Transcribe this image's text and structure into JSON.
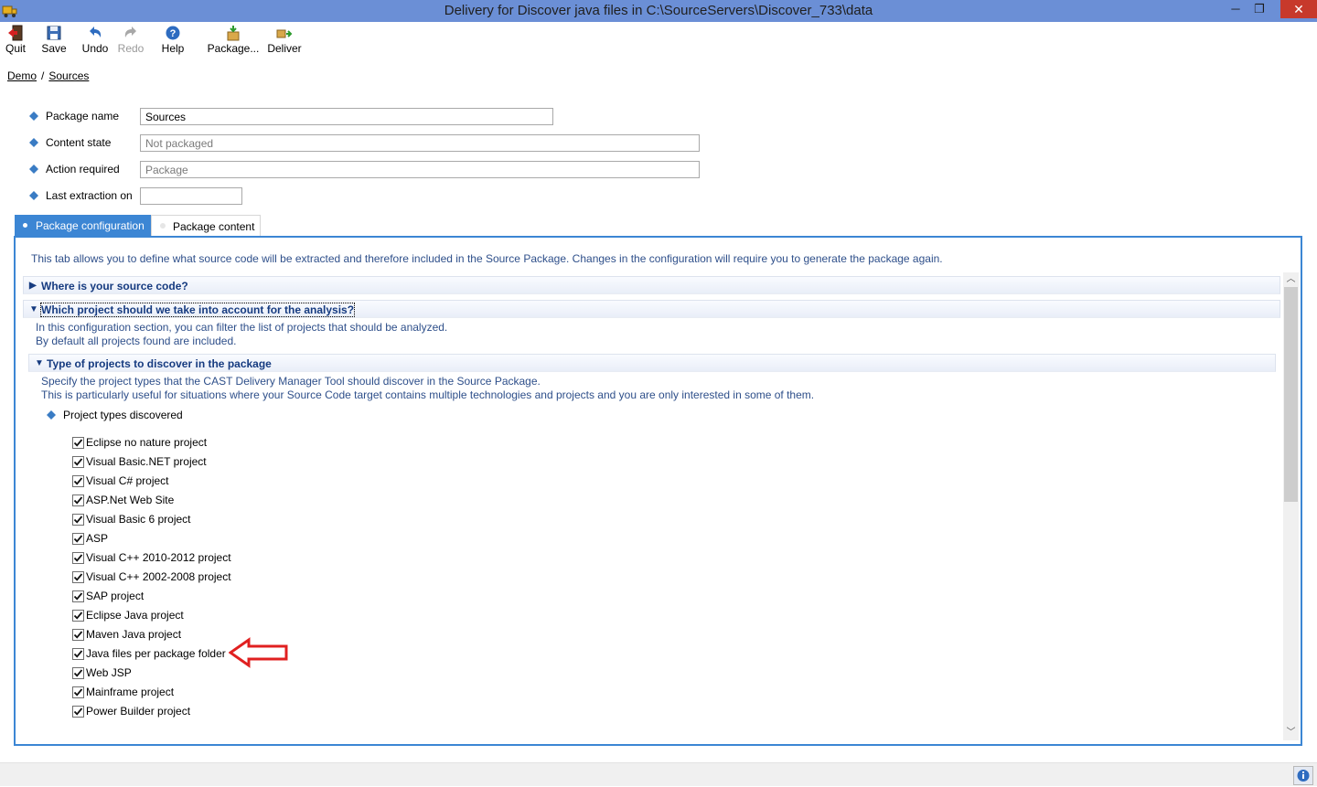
{
  "window": {
    "title": "Delivery for Discover java files in C:\\SourceServers\\Discover_733\\data",
    "minimize_glyph": "─",
    "restore_glyph": "❐",
    "close_glyph": "✕"
  },
  "toolbar": {
    "quit": "Quit",
    "save": "Save",
    "undo": "Undo",
    "redo": "Redo",
    "help": "Help",
    "package": "Package...",
    "deliver": "Deliver"
  },
  "breadcrumb": {
    "root": "Demo",
    "separator": "/",
    "current": "Sources"
  },
  "properties": {
    "package_name": {
      "label": "Package name",
      "value": "Sources"
    },
    "content_state": {
      "label": "Content state",
      "value": "Not packaged"
    },
    "action_required": {
      "label": "Action required",
      "value": "Package"
    },
    "last_extraction": {
      "label": "Last extraction on",
      "value": ""
    }
  },
  "tabs": {
    "config": "Package configuration",
    "content": "Package content"
  },
  "config": {
    "intro": "This tab allows you to define what source code will be extracted and therefore included in the Source Package. Changes in the configuration will require you to generate the package again.",
    "section_source": "Where is your source code?",
    "section_projects": "Which project should we take into account for the analysis?",
    "projects_desc_1": "In this configuration section, you can filter the list of projects that should be analyzed.",
    "projects_desc_2": "By default all projects found are included.",
    "section_types": "Type of projects to discover in the package",
    "types_desc_1": "Specify the project types that the CAST Delivery Manager Tool should discover in the Source Package.",
    "types_desc_2": "This is particularly useful for situations where your Source Code target contains multiple technologies and projects and you are only interested in some of them.",
    "types_label": "Project types discovered",
    "project_types": [
      {
        "label": "Eclipse no nature project",
        "checked": true
      },
      {
        "label": "Visual Basic.NET project",
        "checked": true
      },
      {
        "label": "Visual C# project",
        "checked": true
      },
      {
        "label": "ASP.Net Web Site",
        "checked": true
      },
      {
        "label": "Visual Basic 6 project",
        "checked": true
      },
      {
        "label": "ASP",
        "checked": true
      },
      {
        "label": "Visual C++ 2010-2012 project",
        "checked": true
      },
      {
        "label": "Visual C++ 2002-2008 project",
        "checked": true
      },
      {
        "label": "SAP project",
        "checked": true
      },
      {
        "label": "Eclipse Java project",
        "checked": true
      },
      {
        "label": "Maven Java project",
        "checked": true
      },
      {
        "label": "Java files per package folder",
        "checked": true
      },
      {
        "label": "Web JSP",
        "checked": true
      },
      {
        "label": "Mainframe project",
        "checked": true
      },
      {
        "label": "Power Builder project",
        "checked": true
      }
    ]
  },
  "icons": {
    "quit": "quit-icon",
    "save": "save-icon",
    "undo": "undo-icon",
    "redo": "redo-icon",
    "help": "help-icon",
    "package": "package-icon",
    "deliver": "deliver-icon",
    "info": "info-icon"
  },
  "colors": {
    "titlebar": "#6b8fd6",
    "tab_active": "#3c86d4",
    "section_text": "#163b80",
    "annotation_arrow": "#e02020",
    "close_button": "#c7392b"
  }
}
